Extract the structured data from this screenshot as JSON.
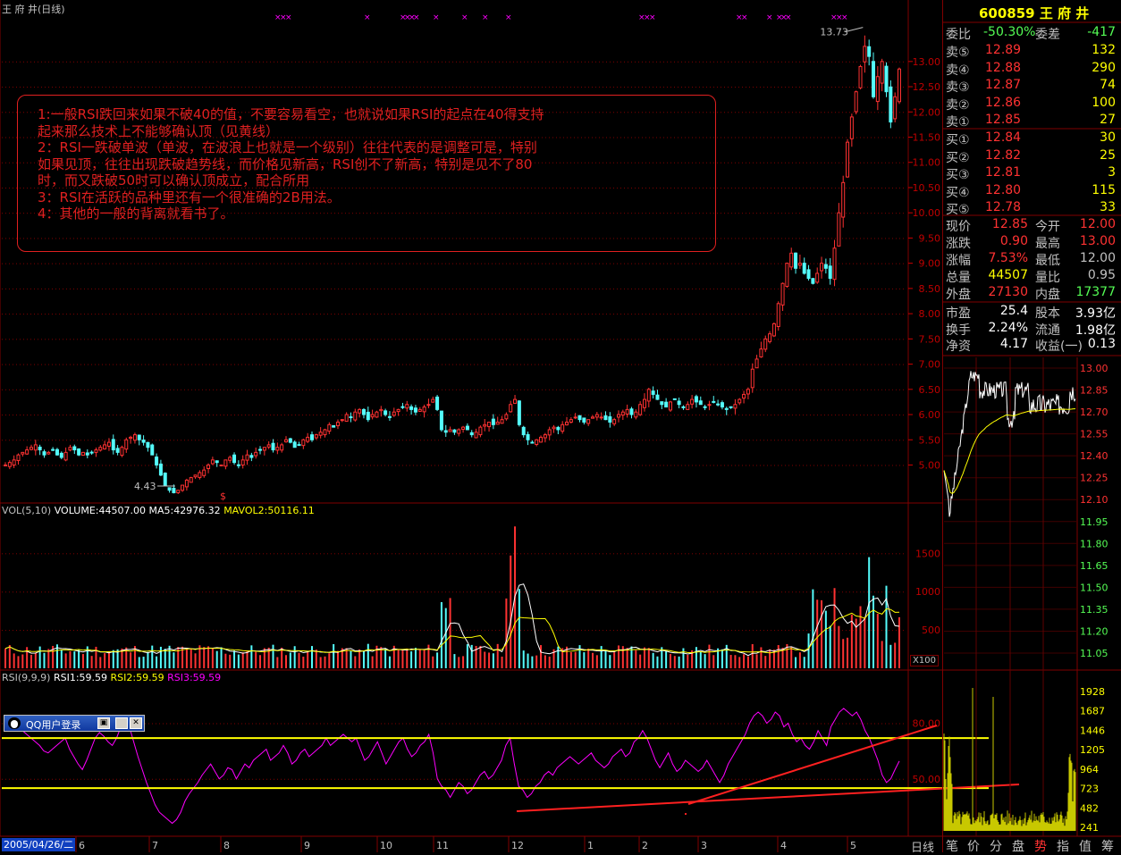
{
  "header": {
    "title": "王 府 井(日线)",
    "vol_legend": "VOL(5,10) VOLUME:44507.00 MA5:42976.32 MAVOL2:50116.11",
    "vol_legend_parts": [
      "VOL(5,10)",
      "VOLUME:44507.00",
      "MA5:42976.32",
      "MAVOL2:50116.11"
    ],
    "rsi_legend_parts": [
      "RSI(9,9,9)",
      "RSI1:59.59",
      "RSI2:59.59",
      "RSI3:59.59"
    ],
    "vol_unit": "X100",
    "period_label": "日线",
    "date_tag": "2005/04/26/二"
  },
  "chart_data": [
    {
      "type": "candlestick",
      "title": "王 府 井(日线)",
      "price_ticks": [
        "13.00",
        "12.50",
        "12.00",
        "11.50",
        "11.00",
        "10.50",
        "10.00",
        "9.50",
        "9.00",
        "8.50",
        "8.00",
        "7.50",
        "7.00",
        "6.50",
        "6.00",
        "5.50",
        "5.00"
      ],
      "price_range": [
        4.3,
        13.9
      ],
      "annotations": [
        {
          "label": "13.73",
          "value": 13.73
        },
        {
          "label": "4.43",
          "value": 4.43
        }
      ],
      "x_month_labels": [
        "6",
        "7",
        "8",
        "9",
        "10",
        "11",
        "12",
        "1",
        "2",
        "3",
        "4",
        "5"
      ],
      "close_series": [
        5.0,
        5.05,
        5.1,
        5.2,
        5.25,
        5.3,
        5.35,
        5.4,
        5.3,
        5.2,
        5.25,
        5.3,
        5.2,
        5.15,
        5.25,
        5.35,
        5.3,
        5.2,
        5.25,
        5.2,
        5.25,
        5.3,
        5.35,
        5.4,
        5.45,
        5.3,
        5.25,
        5.35,
        5.5,
        5.55,
        5.6,
        5.5,
        5.45,
        5.35,
        5.2,
        5.0,
        4.8,
        4.6,
        4.5,
        4.45,
        4.5,
        4.6,
        4.7,
        4.75,
        4.8,
        4.85,
        4.9,
        5.0,
        5.1,
        5.05,
        5.0,
        5.1,
        5.15,
        5.05,
        5.0,
        5.1,
        5.2,
        5.15,
        5.25,
        5.3,
        5.35,
        5.4,
        5.3,
        5.35,
        5.4,
        5.5,
        5.45,
        5.35,
        5.4,
        5.5,
        5.55,
        5.5,
        5.6,
        5.65,
        5.7,
        5.8,
        5.75,
        5.85,
        5.9,
        6.0,
        5.95,
        6.05,
        6.1,
        6.0,
        5.9,
        6.0,
        6.05,
        6.1,
        6.0,
        5.95,
        6.05,
        6.1,
        6.15,
        6.2,
        6.1,
        6.05,
        6.1,
        6.15,
        6.2,
        6.3,
        6.1,
        5.7,
        5.65,
        5.7,
        5.65,
        5.7,
        5.75,
        5.7,
        5.6,
        5.65,
        5.75,
        5.8,
        5.85,
        5.8,
        5.85,
        5.9,
        6.0,
        6.2,
        6.3,
        5.8,
        5.6,
        5.5,
        5.45,
        5.5,
        5.55,
        5.6,
        5.7,
        5.75,
        5.7,
        5.8,
        5.85,
        5.9,
        5.95,
        5.9,
        5.85,
        5.9,
        5.95,
        6.0,
        5.95,
        5.9,
        5.85,
        5.9,
        6.0,
        6.05,
        6.1,
        6.0,
        6.05,
        6.2,
        6.3,
        6.5,
        6.4,
        6.3,
        6.2,
        6.15,
        6.25,
        6.3,
        6.2,
        6.15,
        6.2,
        6.3,
        6.25,
        6.2,
        6.15,
        6.2,
        6.25,
        6.2,
        6.15,
        6.1,
        6.15,
        6.2,
        6.3,
        6.4,
        6.5,
        6.9,
        7.1,
        7.3,
        7.5,
        7.6,
        7.8,
        8.2,
        8.6,
        9.0,
        9.2,
        8.9,
        9.0,
        8.8,
        8.7,
        8.6,
        8.8,
        9.0,
        8.9,
        8.7,
        9.3,
        10.0,
        10.6,
        11.4,
        11.9,
        12.4,
        12.9,
        13.3,
        13.1,
        12.3,
        12.7,
        13.0,
        12.4,
        11.8,
        12.3,
        12.85
      ]
    },
    {
      "type": "bar",
      "title": "VOL(5,10)",
      "y_ticks": [
        "1500",
        "1000",
        "500"
      ],
      "ylim": [
        0,
        1900
      ],
      "series": [
        {
          "name": "VOLUME",
          "last": 44507.0
        },
        {
          "name": "MA5",
          "last": 42976.32
        },
        {
          "name": "MAVOL2",
          "last": 50116.11
        }
      ]
    },
    {
      "type": "line",
      "title": "RSI(9,9,9)",
      "y_ticks": [
        "80.00",
        "50.00"
      ],
      "ylim": [
        20,
        100
      ],
      "series": [
        {
          "name": "RSI1",
          "last": 59.59
        },
        {
          "name": "RSI2",
          "last": 59.59
        },
        {
          "name": "RSI3",
          "last": 59.59
        }
      ],
      "horizontal_lines": [
        72,
        45
      ],
      "values": [
        78,
        80,
        82,
        79,
        76,
        74,
        72,
        70,
        68,
        65,
        64,
        66,
        68,
        70,
        72,
        66,
        62,
        58,
        55,
        60,
        66,
        72,
        75,
        73,
        70,
        68,
        72,
        78,
        82,
        78,
        70,
        62,
        55,
        48,
        42,
        36,
        32,
        30,
        28,
        26,
        28,
        32,
        38,
        42,
        45,
        48,
        52,
        55,
        58,
        54,
        50,
        52,
        56,
        55,
        50,
        54,
        58,
        56,
        60,
        62,
        64,
        66,
        60,
        62,
        64,
        68,
        64,
        58,
        60,
        64,
        66,
        62,
        64,
        66,
        68,
        72,
        68,
        70,
        72,
        74,
        72,
        70,
        72,
        66,
        60,
        62,
        66,
        70,
        64,
        58,
        62,
        66,
        70,
        72,
        66,
        62,
        64,
        68,
        70,
        74,
        64,
        50,
        46,
        44,
        40,
        44,
        48,
        46,
        42,
        44,
        48,
        52,
        54,
        50,
        52,
        56,
        60,
        68,
        72,
        58,
        46,
        44,
        40,
        42,
        46,
        48,
        52,
        54,
        52,
        56,
        58,
        60,
        62,
        60,
        58,
        60,
        62,
        64,
        60,
        58,
        56,
        58,
        62,
        64,
        66,
        62,
        64,
        70,
        72,
        76,
        72,
        66,
        60,
        56,
        60,
        64,
        58,
        54,
        56,
        60,
        58,
        56,
        54,
        56,
        60,
        56,
        52,
        48,
        52,
        58,
        62,
        66,
        70,
        74,
        80,
        84,
        86,
        84,
        80,
        82,
        86,
        84,
        78,
        80,
        74,
        70,
        72,
        68,
        66,
        70,
        76,
        72,
        68,
        78,
        82,
        86,
        88,
        86,
        84,
        86,
        82,
        76,
        72,
        66,
        60,
        52,
        48,
        50,
        55,
        59.59
      ]
    }
  ],
  "markers": {
    "high_label": "13.73",
    "low_label": "4.43",
    "dollar": "$"
  },
  "annotation_box": {
    "lines": [
      "1:一般RSI跌回来如果不破40的值，不要容易看空，也就说如果RSI的起点在40得支持",
      "起来那么技术上不能够确认顶（见黄线）",
      "2：RSI一跌破单波（单波，在波浪上也就是一个级别）往往代表的是调整可是，特别",
      "如果见顶，往往出现跌破趋势线，而价格见新高，RSI创不了新高，特别是见不了80",
      "时，而又跌破50时可以确认顶成立，配合所用",
      "3：RSI在活跃的品种里还有一个很准确的2B用法。",
      "4：其他的一般的背离就看书了。"
    ]
  },
  "qq_window": {
    "title": "QQ用户登录",
    "restore_glyph": "▣",
    "close_glyph": "✕"
  },
  "quote": {
    "code": "600859",
    "name": "王 府 井",
    "webi_label": "委比",
    "webi_value": "-50.30%",
    "weicha_label": "委差",
    "weicha_value": "-417",
    "sell": [
      {
        "label": "卖⑤",
        "price": "12.89",
        "vol": "132"
      },
      {
        "label": "卖④",
        "price": "12.88",
        "vol": "290"
      },
      {
        "label": "卖③",
        "price": "12.87",
        "vol": "74"
      },
      {
        "label": "卖②",
        "price": "12.86",
        "vol": "100"
      },
      {
        "label": "卖①",
        "price": "12.85",
        "vol": "27"
      }
    ],
    "buy": [
      {
        "label": "买①",
        "price": "12.84",
        "vol": "30"
      },
      {
        "label": "买②",
        "price": "12.82",
        "vol": "25"
      },
      {
        "label": "买③",
        "price": "12.81",
        "vol": "3"
      },
      {
        "label": "买④",
        "price": "12.80",
        "vol": "115"
      },
      {
        "label": "买⑤",
        "price": "12.78",
        "vol": "33"
      }
    ],
    "stats": [
      {
        "l1": "现价",
        "v1": "12.85",
        "l2": "今开",
        "v2": "12.00"
      },
      {
        "l1": "涨跌",
        "v1": "0.90",
        "l2": "最高",
        "v2": "13.00"
      },
      {
        "l1": "涨幅",
        "v1": "7.53%",
        "l2": "最低",
        "v2": "12.00"
      },
      {
        "l1": "总量",
        "v1": "44507",
        "l2": "量比",
        "v2": "0.95"
      },
      {
        "l1": "外盘",
        "v1": "27130",
        "l2": "内盘",
        "v2": "17377"
      }
    ],
    "finance": [
      {
        "l1": "市盈",
        "v1": "25.4",
        "l2": "股本",
        "v2": "3.93亿"
      },
      {
        "l1": "换手",
        "v1": "2.24%",
        "l2": "流通",
        "v2": "1.98亿"
      },
      {
        "l1": "净资",
        "v1": "4.17",
        "l2": "收益(一)",
        "v2": "0.13"
      }
    ]
  },
  "intraday": {
    "price_ticks": [
      "13.00",
      "12.85",
      "12.70",
      "12.55",
      "12.40",
      "12.25",
      "12.10",
      "11.95",
      "11.80",
      "11.65",
      "11.50",
      "11.35",
      "11.20",
      "11.05"
    ],
    "vol_ticks": [
      "1928",
      "1687",
      "1446",
      "1205",
      "964",
      "723",
      "482",
      "241"
    ]
  },
  "tabs": [
    "笔",
    "价",
    "分",
    "盘",
    "势",
    "指",
    "值",
    "筹"
  ],
  "colors": {
    "up": "#ff3232",
    "down": "#54fcfc",
    "rsi": "#ff00ff",
    "support": "#ffff00",
    "trend": "#ff2020",
    "grid": "#800000"
  }
}
